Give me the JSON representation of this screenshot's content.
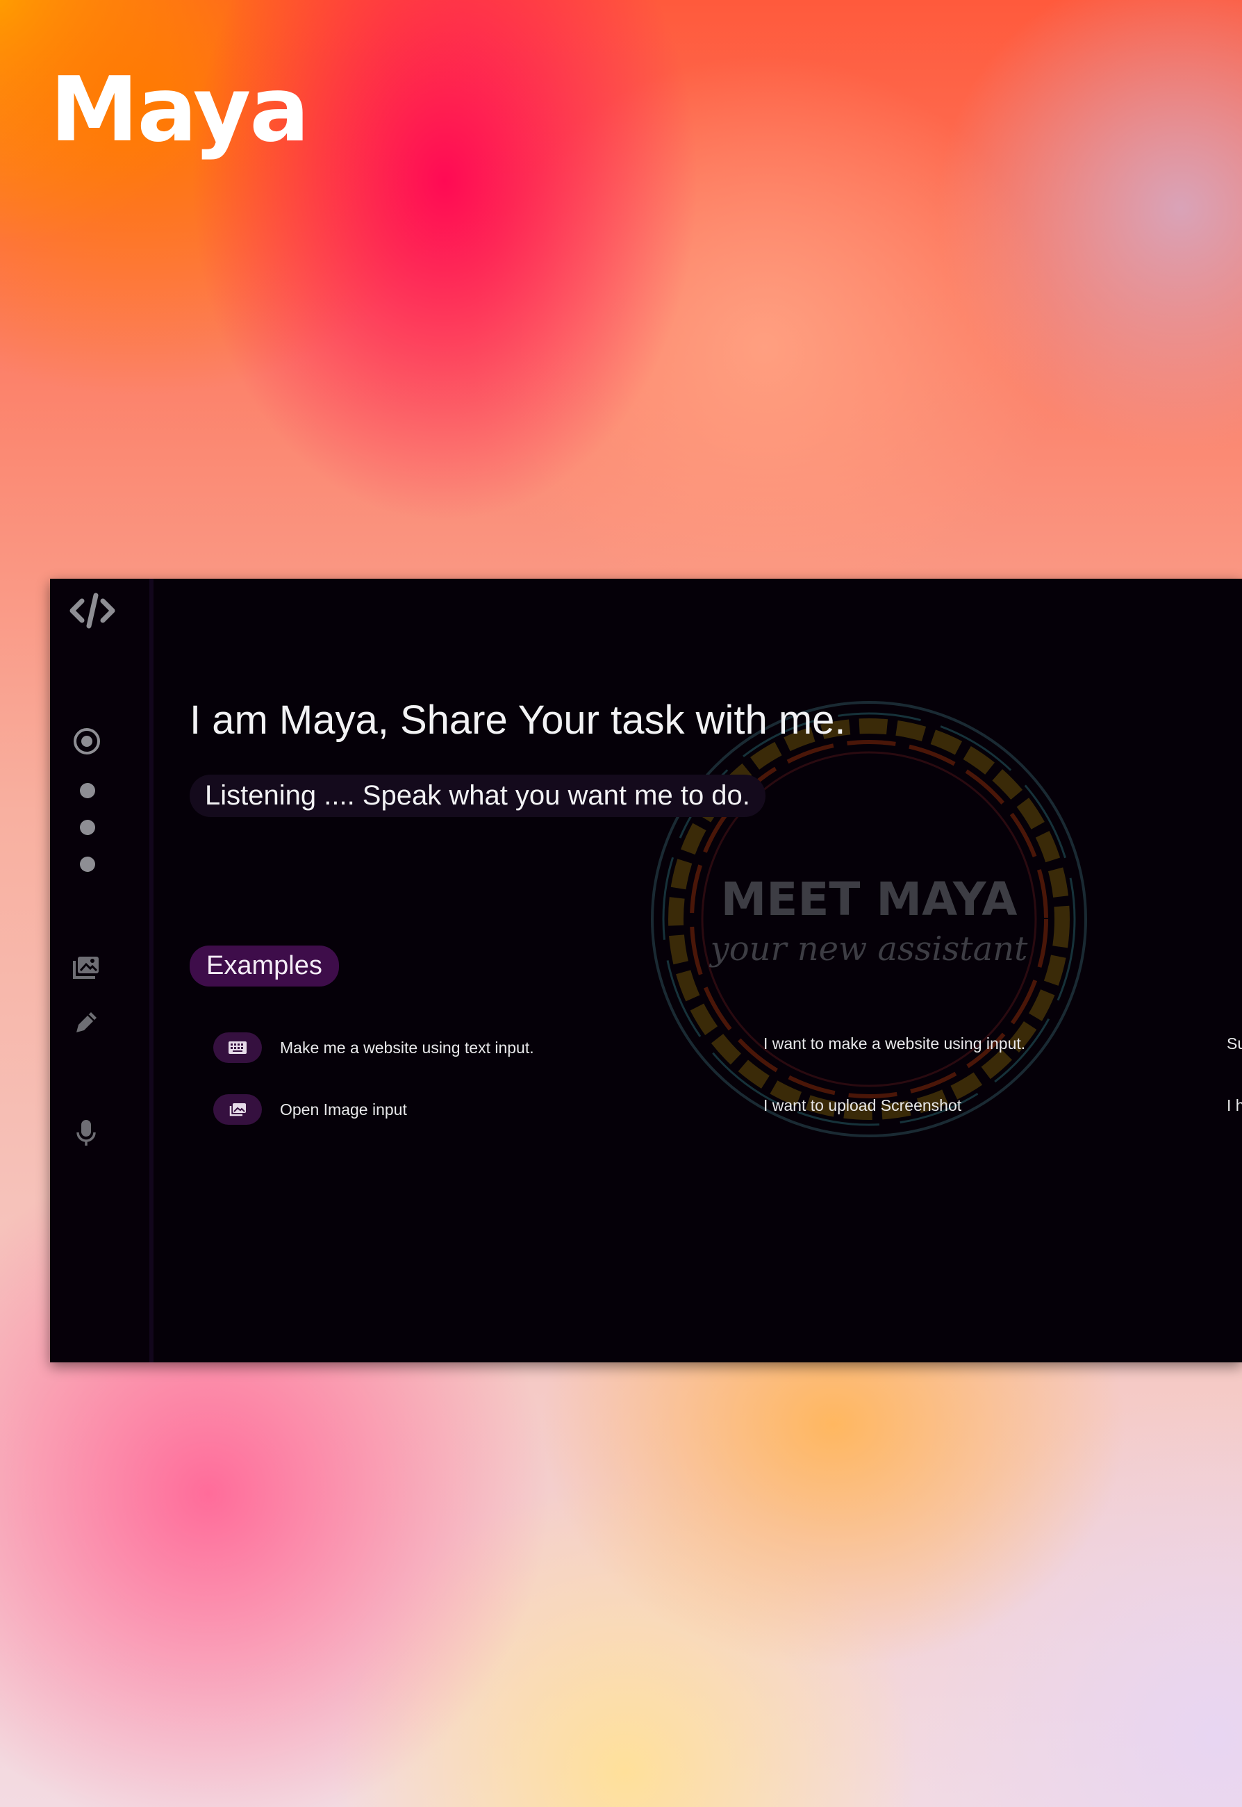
{
  "brand": {
    "title": "Maya"
  },
  "main": {
    "headline": "I am Maya, Share Your task with me.",
    "status": "Listening .... Speak what you want me to do.",
    "examples_label": "Examples",
    "examples": [
      {
        "label": "Make me a website using text input.",
        "icon": "keyboard-icon"
      },
      {
        "label": "Open Image input",
        "icon": "image-icon"
      }
    ],
    "prompts_col1": [
      "I want to make a website using input.",
      "I want to upload Screenshot"
    ],
    "prompts_col2": [
      "Su",
      "I h"
    ]
  },
  "badge": {
    "title": "MEET MAYA",
    "subtitle": "your new assistant"
  },
  "sidebar": {
    "logo_icon": "code-icon",
    "icons": [
      "radio-icon",
      "dot-icon",
      "dot-icon",
      "dot-icon",
      "gallery-icon",
      "pencil-icon",
      "microphone-icon"
    ]
  },
  "colors": {
    "panel": "#050008",
    "accent": "#3e0d4a",
    "text": "#f2f2f4",
    "muted_icon": "#8e8e94"
  }
}
